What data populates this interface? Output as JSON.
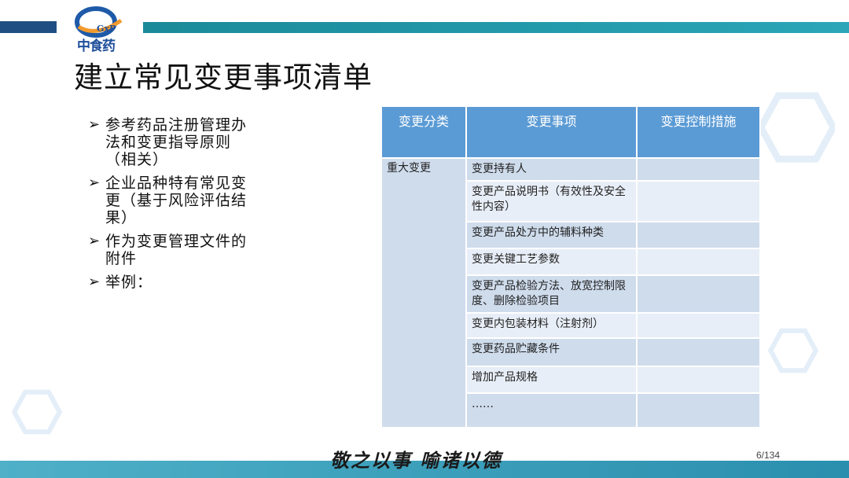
{
  "logo": {
    "brand": "中食药",
    "badge": "GxP"
  },
  "title": "建立常见变更事项清单",
  "bullets": [
    "参考药品注册管理办法和变更指导原则（相关）",
    "企业品种特有常见变更（基于风险评估结果）",
    "作为变更管理文件的附件",
    "举例："
  ],
  "table": {
    "headers": [
      "变更分类",
      "变更事项",
      "变更控制措施"
    ],
    "category": "重大变更",
    "items": [
      "变更持有人",
      "变更产品说明书（有效性及安全性内容）",
      "变更产品处方中的辅料种类",
      "变更关键工艺参数",
      "变更产品检验方法、放宽控制限度、删除检验项目",
      "变更内包装材料（注射剂）",
      "变更药品贮藏条件",
      "增加产品规格",
      "……"
    ]
  },
  "footer": {
    "motto": "敬之以事 喻诸以德",
    "page": "6/134"
  },
  "colors": {
    "header_bg": "#5b9bd5",
    "row_dark": "#cfdcec",
    "row_light": "#e8eef7",
    "top_bar_navy": "#1e4e82",
    "top_bar_teal": "#1a8a99"
  }
}
